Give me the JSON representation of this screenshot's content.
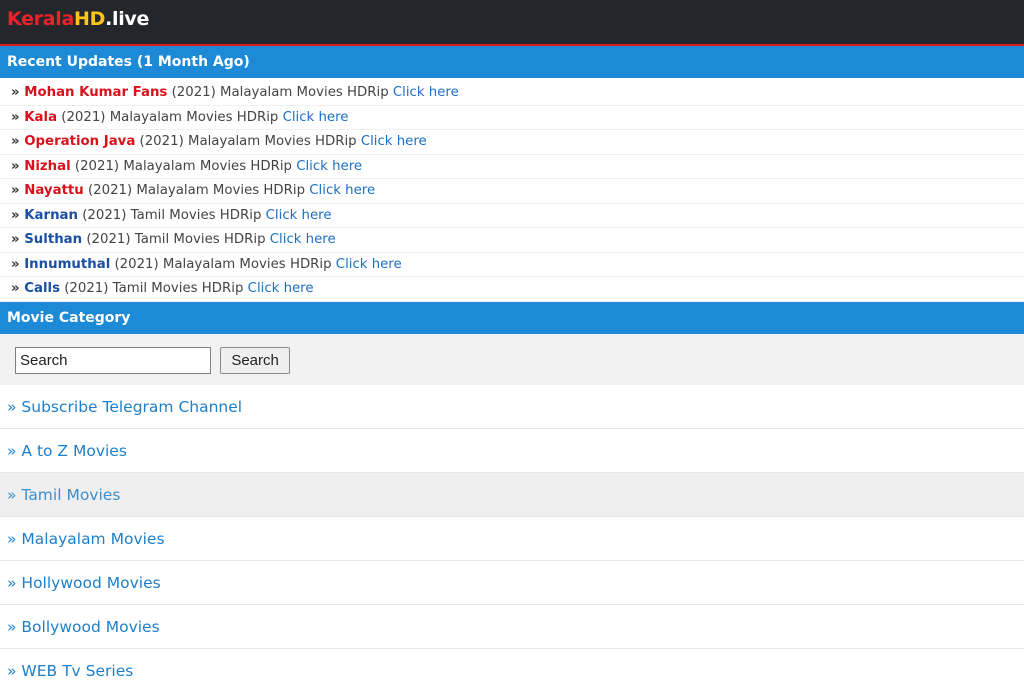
{
  "site": {
    "logo_part1": "Kerala",
    "logo_part2": "HD",
    "logo_part3": ".live"
  },
  "recent": {
    "title": "Recent Updates (1 Month Ago)",
    "items": [
      {
        "title": "Mohan Kumar Fans",
        "desc": " (2021) Malayalam Movies HDRip ",
        "link": "Click here",
        "color": "red"
      },
      {
        "title": "Kala",
        "desc": " (2021) Malayalam Movies HDRip ",
        "link": "Click here",
        "color": "red"
      },
      {
        "title": "Operation Java",
        "desc": " (2021) Malayalam Movies HDRip ",
        "link": "Click here",
        "color": "red"
      },
      {
        "title": "Nizhal",
        "desc": " (2021) Malayalam Movies HDRip ",
        "link": "Click here",
        "color": "red"
      },
      {
        "title": "Nayattu",
        "desc": " (2021) Malayalam Movies HDRip ",
        "link": "Click here",
        "color": "red"
      },
      {
        "title": "Karnan",
        "desc": " (2021) Tamil Movies HDRip ",
        "link": "Click here",
        "color": "blue"
      },
      {
        "title": "Sulthan",
        "desc": " (2021) Tamil Movies HDRip ",
        "link": "Click here",
        "color": "blue"
      },
      {
        "title": "Innumuthal",
        "desc": " (2021) Malayalam Movies HDRip ",
        "link": "Click here",
        "color": "blue"
      },
      {
        "title": "Calls",
        "desc": " (2021) Tamil Movies HDRip ",
        "link": "Click here",
        "color": "blue"
      }
    ]
  },
  "category": {
    "title": "Movie Category",
    "search_value": "Search",
    "search_button": "Search",
    "items": [
      {
        "label": "» Subscribe Telegram Channel",
        "active": false
      },
      {
        "label": "» A to Z Movies",
        "active": false
      },
      {
        "label": "» Tamil Movies",
        "active": true
      },
      {
        "label": "» Malayalam Movies",
        "active": false
      },
      {
        "label": "» Hollywood Movies",
        "active": false
      },
      {
        "label": "» Bollywood Movies",
        "active": false
      },
      {
        "label": "» WEB Tv Series",
        "active": false
      }
    ]
  },
  "colors": {
    "header_bg": "#24262b",
    "accent_red": "#e01b1b",
    "section_blue": "#1d8ad8",
    "title_red": "#d8121b",
    "title_blue": "#1a4fa3",
    "link_blue": "#1d6fc4"
  }
}
